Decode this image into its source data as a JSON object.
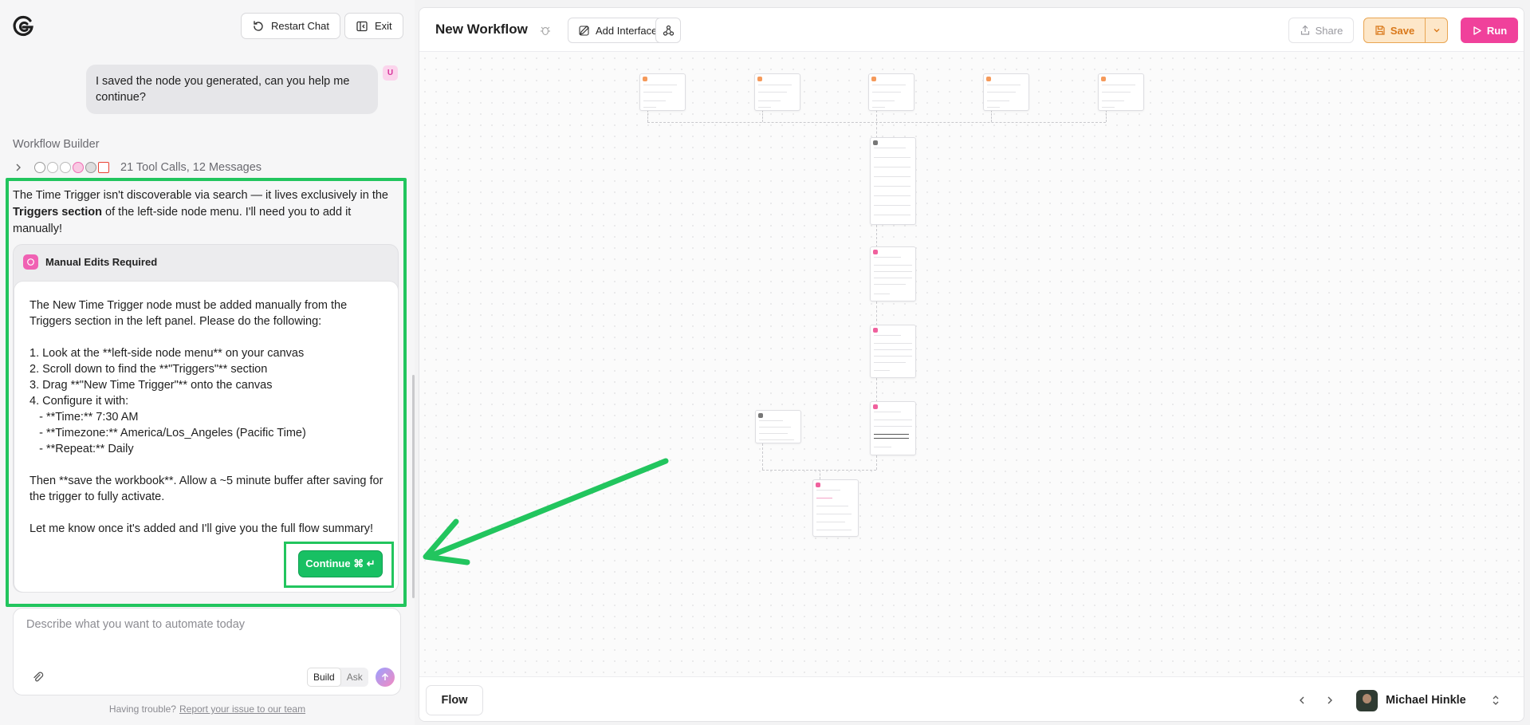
{
  "chat": {
    "restart_label": "Restart Chat",
    "exit_label": "Exit",
    "user_message": "I saved the node you generated, can you help me continue?",
    "user_avatar": "U",
    "section_title": "Workflow Builder",
    "tool_summary": "21 Tool Calls, 12 Messages",
    "assistant_text_a": "The Time Trigger isn't discoverable via search — it lives exclusively in the ",
    "assistant_text_bold": "Triggers section",
    "assistant_text_b": " of the left-side node menu. I'll need you to add it manually!",
    "card_title": "Manual Edits Required",
    "card_text": "The New Time Trigger node must be added manually from the Triggers section in the left panel. Please do the following:\n\n1. Look at the **left-side node menu** on your canvas\n2. Scroll down to find the **\"Triggers\"** section\n3. Drag **\"New Time Trigger\"** onto the canvas\n4. Configure it with:\n   - **Time:** 7:30 AM\n   - **Timezone:** America/Los_Angeles (Pacific Time)\n   - **Repeat:** Daily\n\nThen **save the workbook**. Allow a ~5 minute buffer after saving for the trigger to fully activate.\n\nLet me know once it's added and I'll give you the full flow summary!",
    "continue_label": "Continue ⌘ ↵",
    "composer_placeholder": "Describe what you want to automate today",
    "mode_build": "Build",
    "mode_ask": "Ask",
    "help_text": "Having trouble?",
    "help_link": "Report your issue to our team"
  },
  "workflow": {
    "title": "New Workflow",
    "add_interface_label": "Add Interface",
    "share_label": "Share",
    "save_label": "Save",
    "run_label": "Run"
  },
  "bottombar": {
    "tab_label": "Flow",
    "user_name": "Michael Hinkle"
  },
  "colors": {
    "highlight": "#22c55e",
    "run": "#f0419b",
    "save_bg": "#fde7c9",
    "save_text": "#d9781a",
    "continue": "#18c063"
  },
  "icons": [
    "logo-icon",
    "restart-icon",
    "exit-icon",
    "chevron-right-icon",
    "manual-edit-icon",
    "paperclip-icon",
    "send-icon",
    "bug-icon",
    "add-interface-icon",
    "webhook-icon",
    "share-icon",
    "save-icon",
    "chevron-down-icon",
    "play-icon",
    "chevron-left-icon",
    "updown-icon",
    "arrow-annotation"
  ]
}
